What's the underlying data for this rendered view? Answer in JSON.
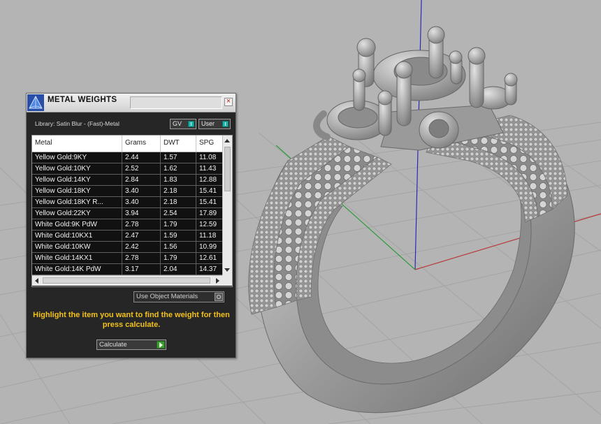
{
  "panel": {
    "title": "METAL WEIGHTS",
    "close_glyph": "×",
    "library_label": "Library: Satin Blur - (Fast)-Metal",
    "toggle_gv": "GV",
    "toggle_user": "User",
    "columns": [
      "Metal",
      "Grams",
      "DWT",
      "SPG"
    ],
    "rows": [
      {
        "metal": "Yellow Gold:9KY",
        "grams": "2.44",
        "dwt": "1.57",
        "spg": "11.08"
      },
      {
        "metal": "Yellow Gold:10KY",
        "grams": "2.52",
        "dwt": "1.62",
        "spg": "11.43"
      },
      {
        "metal": "Yellow Gold:14KY",
        "grams": "2.84",
        "dwt": "1.83",
        "spg": "12.88"
      },
      {
        "metal": "Yellow Gold:18KY",
        "grams": "3.40",
        "dwt": "2.18",
        "spg": "15.41"
      },
      {
        "metal": "Yellow Gold:18KY R...",
        "grams": "3.40",
        "dwt": "2.18",
        "spg": "15.41"
      },
      {
        "metal": "Yellow Gold:22KY",
        "grams": "3.94",
        "dwt": "2.54",
        "spg": "17.89"
      },
      {
        "metal": "White Gold:9K PdW",
        "grams": "2.78",
        "dwt": "1.79",
        "spg": "12.59"
      },
      {
        "metal": "White Gold:10KX1",
        "grams": "2.47",
        "dwt": "1.59",
        "spg": "11.18"
      },
      {
        "metal": "White Gold:10KW",
        "grams": "2.42",
        "dwt": "1.56",
        "spg": "10.99"
      },
      {
        "metal": "White Gold:14KX1",
        "grams": "2.78",
        "dwt": "1.79",
        "spg": "12.61"
      },
      {
        "metal": "White Gold:14K PdW",
        "grams": "3.17",
        "dwt": "2.04",
        "spg": "14.37"
      }
    ],
    "use_object_materials": "Use Object Materials",
    "instruction": "Highlight the item you want to find the weight for then press calculate.",
    "calculate_label": "Calculate"
  },
  "colors": {
    "viewport_bg": "#b4b4b4",
    "grid_line": "#a4a4a4",
    "axis_x": "#b83a3a",
    "axis_y": "#2f9a3a",
    "axis_z": "#2a2ab8",
    "instruction_text": "#f2c21a"
  },
  "icons": {
    "logo": "pyramid-logo-icon",
    "close": "close-icon",
    "toggle": "toggle-knob-icon",
    "calculate": "play-arrow-icon"
  }
}
